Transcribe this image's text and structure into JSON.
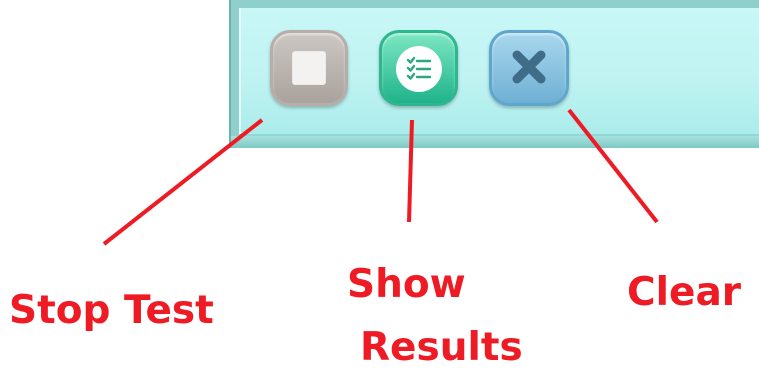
{
  "toolbar": {
    "buttons": [
      {
        "id": "stop-test",
        "icon": "stop-square-icon",
        "color": "#b3aca7"
      },
      {
        "id": "show-results",
        "icon": "checklist-icon",
        "color": "#27b98f"
      },
      {
        "id": "clear",
        "icon": "close-x-icon",
        "color": "#7fb9d9"
      }
    ],
    "panel_color": "#bff3f2"
  },
  "annotations": {
    "color": "#ee1b24",
    "stop_test_label": "Stop Test",
    "show_label": "Show",
    "results_label": "Results",
    "clear_label": "Clear"
  }
}
